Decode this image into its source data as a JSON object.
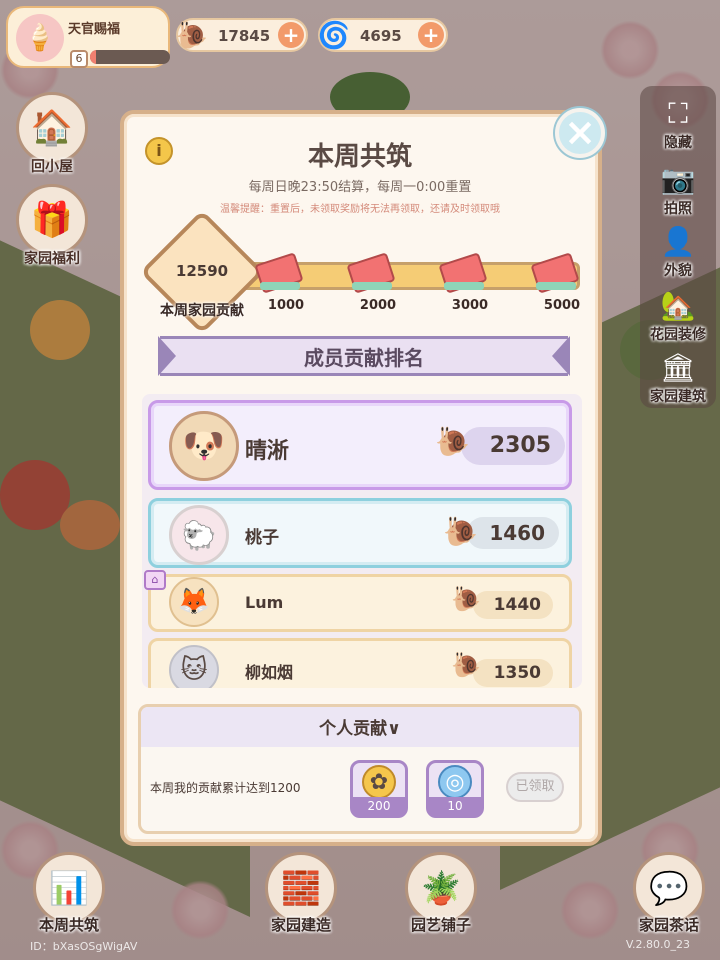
{
  "player": {
    "title": "天官赐福",
    "level": "6",
    "exp_fraction": 0.08
  },
  "currencies": [
    {
      "icon": "snail-coin-icon",
      "value": "17845"
    },
    {
      "icon": "blue-swirl-gem-icon",
      "value": "4695"
    }
  ],
  "left_buttons": [
    {
      "label": "回小屋",
      "icon": "house-icon"
    },
    {
      "label": "家园福利",
      "icon": "gift-icon"
    }
  ],
  "right_menu": [
    {
      "label": "隐藏",
      "icon": "hide-frame-icon"
    },
    {
      "label": "拍照",
      "icon": "camera-icon"
    },
    {
      "label": "外貌",
      "icon": "avatar-icon"
    },
    {
      "label": "花园装修",
      "icon": "garden-house-icon"
    },
    {
      "label": "家园建筑",
      "icon": "building-icon"
    }
  ],
  "dialog": {
    "title": "本周共筑",
    "subtitle": "每周日晚23:50结算，每周一0:00重置",
    "note": "温馨提醒：重置后，未领取奖励将无法再领取，还请及时领取哦",
    "contribution_value": "12590",
    "contribution_label": "本周家园贡献",
    "milestones": [
      "1000",
      "2000",
      "3000",
      "5000"
    ],
    "ranking_title": "成员贡献排名",
    "members": [
      {
        "name": "晴淅",
        "value": "2305"
      },
      {
        "name": "桃子",
        "value": "1460"
      },
      {
        "name": "Lum",
        "value": "1440"
      },
      {
        "name": "柳如烟",
        "value": "1350"
      }
    ],
    "personal": {
      "title": "个人贡献∨",
      "description": "本周我的贡献累计达到1200",
      "rewards": [
        {
          "icon": "gold-coin-icon",
          "quantity": "200"
        },
        {
          "icon": "blue-swirl-gem-icon",
          "quantity": "10"
        }
      ],
      "claim_label": "已领取"
    }
  },
  "bottom_nav": [
    {
      "label": "本周共筑",
      "icon": "leaderboard-icon"
    },
    {
      "label": "家园建造",
      "icon": "build-trowel-icon"
    },
    {
      "label": "园艺铺子",
      "icon": "flower-pot-icon"
    },
    {
      "label": "家园茶话",
      "icon": "chat-bubbles-icon"
    }
  ],
  "footer": {
    "id_text": "ID：bXasOSgWigAV",
    "version": "V.2.80.0_23"
  },
  "colors": {
    "accent_purple": "#9a86b8",
    "gold": "#f5c15a",
    "plus_orange": "#f29a6a"
  }
}
